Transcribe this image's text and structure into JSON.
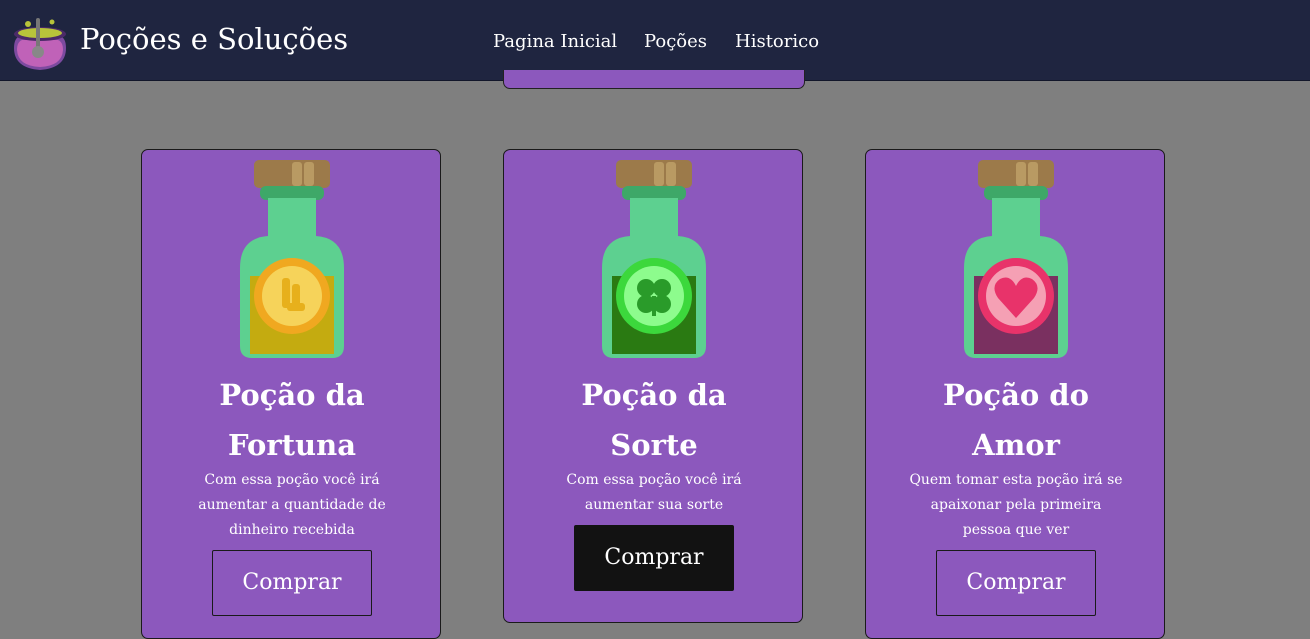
{
  "header": {
    "brand": "Poções e Soluções",
    "nav": [
      {
        "label": "Pagina Inicial"
      },
      {
        "label": "Poções"
      },
      {
        "label": "Historico"
      }
    ]
  },
  "products": [
    {
      "title": "Poção da Fortuna",
      "description": "Com essa poção você irá aumentar a quantidade de dinheiro recebida",
      "button": "Comprar",
      "icon": "coin-potion-icon"
    },
    {
      "title": "Poção da Sorte",
      "description": "Com essa poção você irá aumentar sua sorte",
      "button": "Comprar",
      "icon": "clover-potion-icon"
    },
    {
      "title": "Poção do Amor",
      "description": "Quem tomar esta poção irá se apaixonar pela primeira pessoa que ver",
      "button": "Comprar",
      "icon": "heart-potion-icon"
    }
  ],
  "colors": {
    "header": "#1f2540",
    "card": "#8c58bd",
    "background": "#7f7f7f",
    "button_hover": "#121212"
  }
}
